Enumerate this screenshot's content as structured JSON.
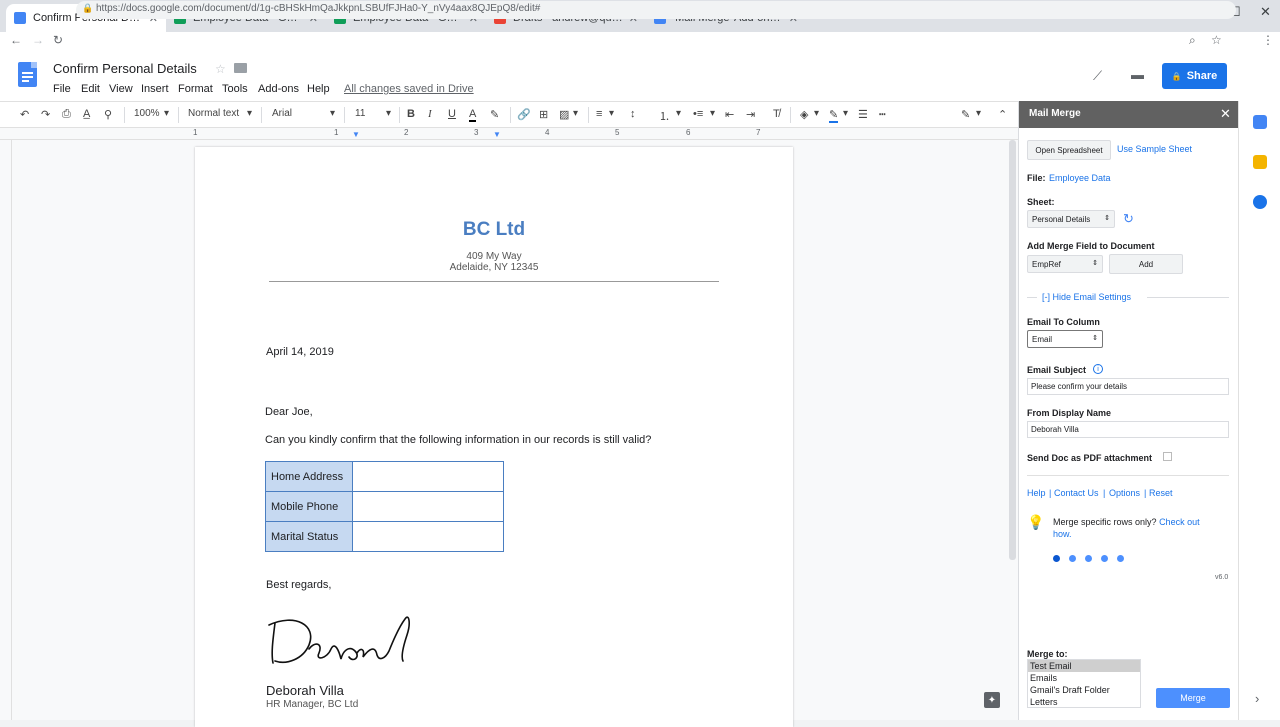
{
  "tabs": [
    {
      "label": "Confirm Personal Details - Google",
      "fav_color": "#4285f4",
      "active": true
    },
    {
      "label": "Employee Data - Google Sheets",
      "fav_color": "#0f9d58",
      "active": false
    },
    {
      "label": "Employee Data - Google Sheets",
      "fav_color": "#0f9d58",
      "active": false
    },
    {
      "label": "Drafts - andrew@quicklution.com",
      "fav_color": "#ea4335",
      "active": false
    },
    {
      "label": "'Mail Merge' Add-on - Contact U",
      "fav_color": "#4285f4",
      "active": false
    }
  ],
  "address": {
    "url": "https://docs.google.com/document/d/1g-cBHSkHmQaJkkpnLSBUfFJHa0-Y_nVy4aax8QJEpQ8/edit#"
  },
  "doc": {
    "title": "Confirm Personal Details",
    "menus": [
      "File",
      "Edit",
      "View",
      "Insert",
      "Format",
      "Tools",
      "Add-ons",
      "Help"
    ],
    "save_status": "All changes saved in Drive",
    "share_label": "Share"
  },
  "toolbar": {
    "zoom": "100%",
    "style": "Normal text",
    "font": "Arial",
    "size": "11"
  },
  "ruler": [
    "1",
    "1",
    "2",
    "3",
    "4",
    "5",
    "6",
    "7"
  ],
  "letter": {
    "company": "BC Ltd",
    "address_line1": "409 My Way",
    "address_line2": "Adelaide, NY 12345",
    "date": "April 14, 2019",
    "greeting": "Dear Joe,",
    "body": "Can you kindly confirm that the following information in our records is still valid?",
    "table": [
      {
        "label": "Home Address",
        "value": ""
      },
      {
        "label": "Mobile Phone",
        "value": ""
      },
      {
        "label": "Marital Status",
        "value": ""
      }
    ],
    "closing": "Best regards,",
    "signer_name": "Deborah Villa",
    "signer_title": "HR Manager, BC Ltd"
  },
  "panel": {
    "title": "Mail Merge",
    "open_spreadsheet": "Open Spreadsheet",
    "use_sample": "Use Sample Sheet",
    "file_label": "File:",
    "file_value": "Employee Data",
    "sheet_label": "Sheet:",
    "sheet_value": "Personal Details",
    "add_field_label": "Add Merge Field to Document",
    "field_value": "EmpRef",
    "add_button": "Add",
    "hide_settings": "[-] Hide Email Settings",
    "email_to_label": "Email To Column",
    "email_to_value": "Email",
    "subject_label": "Email Subject",
    "subject_value": "Please confirm your details",
    "from_label": "From Display Name",
    "from_value": "Deborah Villa",
    "pdf_label": "Send Doc as PDF attachment",
    "links": {
      "help": "Help",
      "contact": "Contact Us",
      "options": "Options",
      "reset": "Reset",
      "sep": "|"
    },
    "tip_text": "Merge specific rows only?",
    "tip_link": "Check out how.",
    "version": "v6.0",
    "merge_to_label": "Merge to:",
    "merge_options": [
      "Test Email",
      "Emails",
      "Gmail's Draft Folder",
      "Letters"
    ],
    "merge_selected": "Test Email",
    "merge_button": "Merge"
  },
  "colors": {
    "accent": "#1a73e8",
    "heading": "#4a7ec1",
    "table_fill": "#c6d9f1",
    "panel_header": "#616161"
  }
}
